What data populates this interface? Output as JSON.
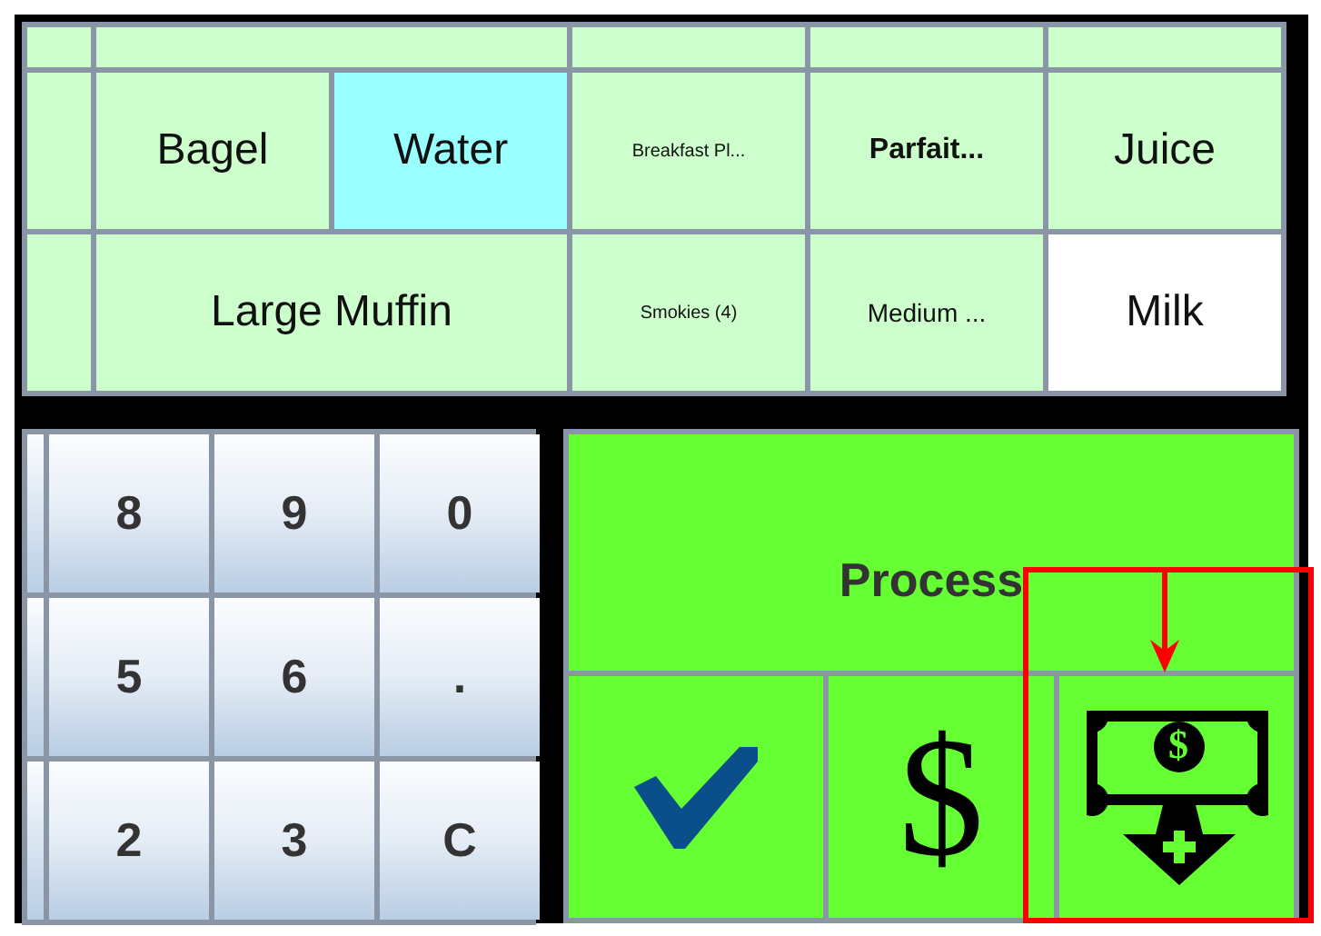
{
  "menu_rows": [
    {
      "items": [
        {
          "label": "Bagel",
          "kind": "large",
          "wide": false,
          "color": "#ccffcc"
        },
        {
          "label": "Water",
          "kind": "large",
          "wide": false,
          "color": "#99ffff"
        },
        {
          "label": "Breakfast Pl...",
          "kind": "small",
          "wide": false,
          "color": "#ccffcc"
        },
        {
          "label": "Parfait...",
          "kind": "bold",
          "wide": false,
          "color": "#ccffcc"
        },
        {
          "label": "Juice",
          "kind": "large",
          "wide": false,
          "color": "#ccffcc"
        }
      ]
    },
    {
      "items": [
        {
          "label": "Large Muffin",
          "kind": "large",
          "wide": true,
          "color": "#ccffcc"
        },
        {
          "label": "Smokies (4)",
          "kind": "small",
          "wide": false,
          "color": "#ccffcc"
        },
        {
          "label": "Medium ...",
          "kind": "medium",
          "wide": false,
          "color": "#ccffcc"
        },
        {
          "label": "Milk",
          "kind": "large",
          "wide": false,
          "color": "#ffffff"
        }
      ]
    }
  ],
  "keypad": [
    "8",
    "9",
    "0",
    "5",
    "6",
    ".",
    "2",
    "3",
    "C"
  ],
  "tender": {
    "process": "Process",
    "buttons": [
      {
        "kind": "check"
      },
      {
        "kind": "text",
        "label": "$"
      },
      {
        "kind": "cash",
        "symbol": "$"
      }
    ]
  }
}
